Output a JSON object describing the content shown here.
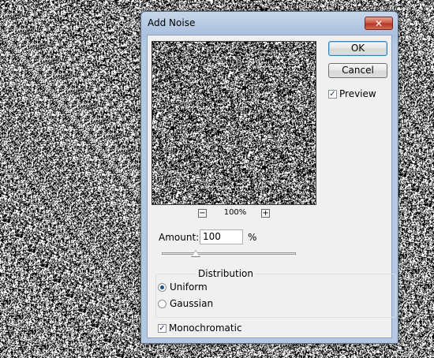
{
  "window": {
    "title": "Add Noise",
    "close_label": "✕"
  },
  "buttons": {
    "ok": "OK",
    "cancel": "Cancel"
  },
  "preview": {
    "checkbox_label": "Preview",
    "checked": true,
    "zoom_level": "100%",
    "zoom_out": "−",
    "zoom_in": "+"
  },
  "amount": {
    "label": "Amount:",
    "value": "100",
    "unit": "%",
    "slider_fraction": 0.25
  },
  "distribution": {
    "legend": "Distribution",
    "options": [
      {
        "label": "Uniform",
        "selected": true
      },
      {
        "label": "Gaussian",
        "selected": false
      }
    ]
  },
  "monochromatic": {
    "label": "Monochromatic",
    "checked": true
  },
  "colors": {
    "accent": "#3c7fb1",
    "title_bar": "#b4c8e2",
    "close": "#c8523f"
  }
}
